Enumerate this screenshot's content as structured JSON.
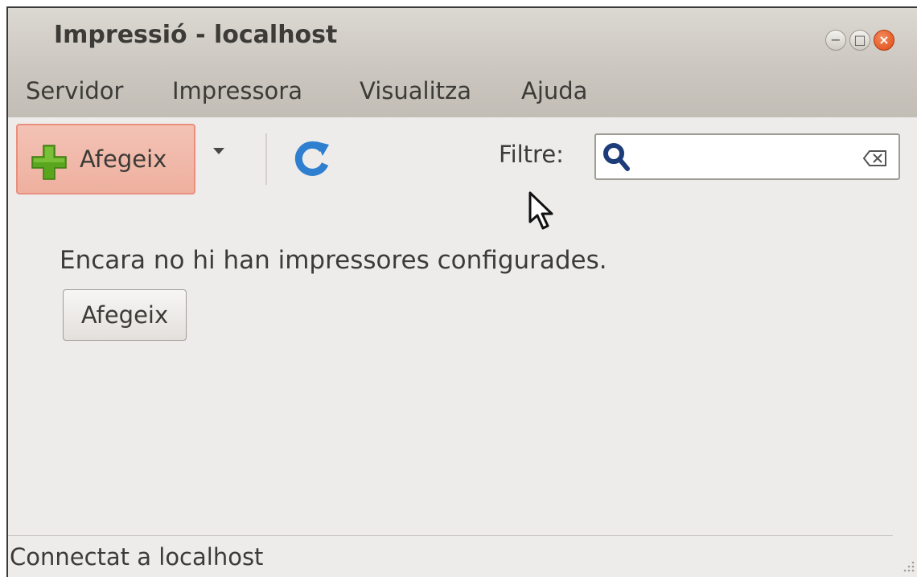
{
  "window": {
    "title": "Impressió - localhost",
    "controls": {
      "minimize_glyph": "−",
      "maximize_glyph": "□",
      "close_glyph": "×"
    }
  },
  "menubar": {
    "items": [
      "Servidor",
      "Impressora",
      "Visualitza",
      "Ajuda"
    ]
  },
  "toolbar": {
    "add_label": "Afegeix",
    "add_icon": "plus-icon",
    "dropdown_icon": "dropdown-arrow-icon",
    "refresh_icon": "refresh-icon",
    "filter_label": "Filtre:",
    "search": {
      "value": "",
      "search_icon": "search-icon",
      "clear_icon": "clear-icon"
    }
  },
  "main": {
    "empty_message": "Encara no hi han impressores configurades.",
    "add_button_label": "Afegeix"
  },
  "statusbar": {
    "text": "Connectat a localhost"
  },
  "colors": {
    "titlebar": "#cbc6bf",
    "window_bg": "#edeceb",
    "add_highlight": "#eeb09f",
    "plus_green": "#5aa51e",
    "refresh_blue": "#2f7fd0",
    "close_orange": "#df4a16"
  }
}
